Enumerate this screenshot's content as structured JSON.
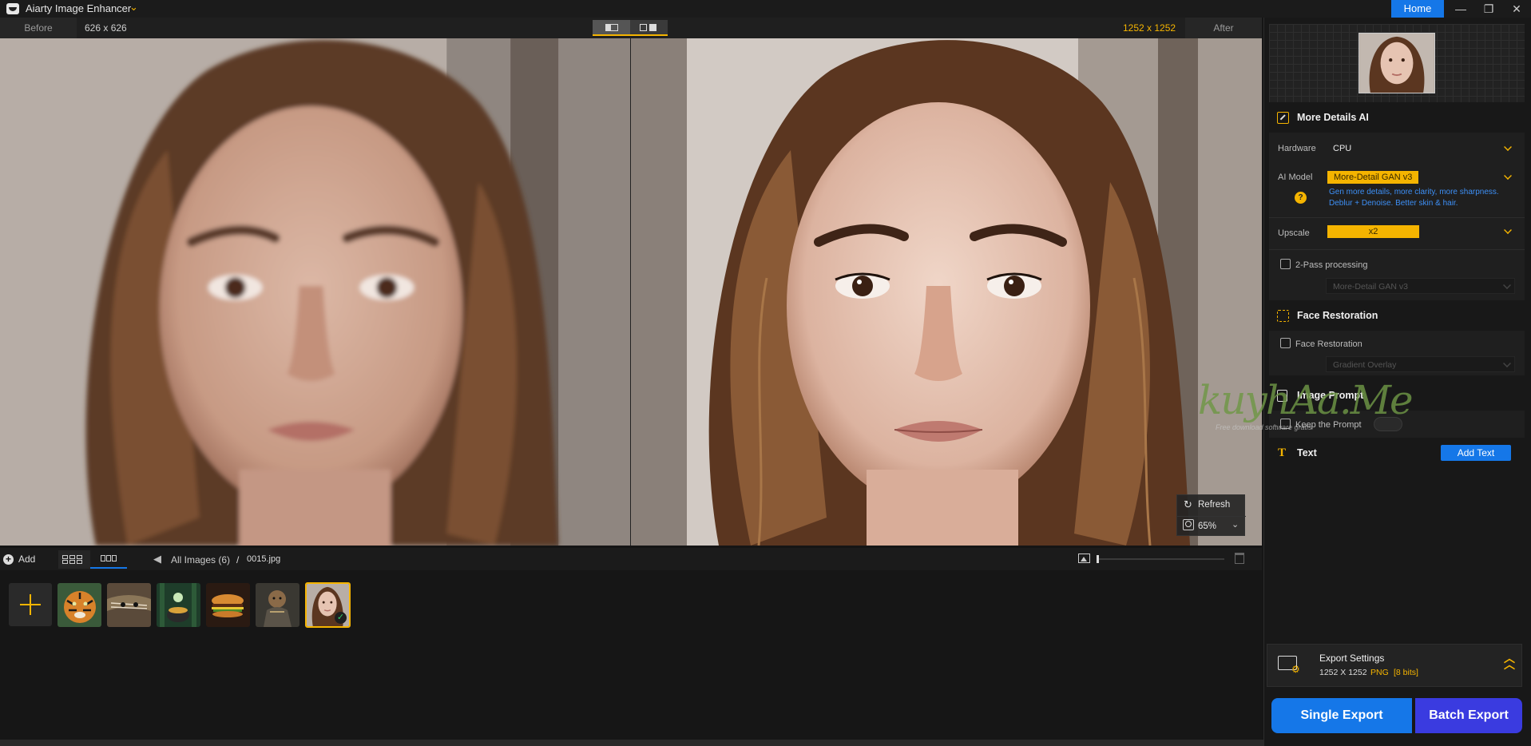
{
  "app": {
    "title": "Aiarty Image Enhancer",
    "home_label": "Home"
  },
  "window_controls": {
    "minimize": "—",
    "restore": "❐",
    "close": "✕"
  },
  "compare": {
    "before_label": "Before",
    "before_dims": "626 x 626",
    "after_dims": "1252 x 1252",
    "after_label": "After"
  },
  "overlay": {
    "refresh_label": "Refresh",
    "zoom_value": "65%"
  },
  "toolbar": {
    "add_label": "Add",
    "breadcrumb_all": "All Images (6)",
    "breadcrumb_sep": "/",
    "breadcrumb_file": "0015.jpg",
    "size_slider_percent": 0
  },
  "thumbnails": [
    {
      "name": "tiger",
      "selected": false
    },
    {
      "name": "owl-feathers",
      "selected": false
    },
    {
      "name": "forest-cauldron",
      "selected": false
    },
    {
      "name": "burger",
      "selected": false
    },
    {
      "name": "armored-figure",
      "selected": false
    },
    {
      "name": "portrait-woman",
      "selected": true
    }
  ],
  "panel": {
    "more_details": {
      "title": "More Details AI",
      "hardware_label": "Hardware",
      "hardware_value": "CPU",
      "ai_model_label": "AI Model",
      "ai_model_value": "More-Detail GAN  v3",
      "ai_model_desc_1": "Gen more details, more clarity, more sharpness.",
      "ai_model_desc_2": "Deblur + Denoise. Better skin & hair.",
      "help_glyph": "?",
      "upscale_label": "Upscale",
      "upscale_value": "x2",
      "two_pass_label": "2-Pass processing",
      "two_pass_model": "More-Detail GAN  v3"
    },
    "face_restoration": {
      "title": "Face Restoration",
      "checkbox_label": "Face Restoration",
      "model": "Gradient Overlay"
    },
    "image_prompt": {
      "title": "Image Prompt",
      "keep_label": "Keep the Prompt"
    },
    "text": {
      "title": "Text",
      "add_text_label": "Add Text"
    },
    "export": {
      "title": "Export Settings",
      "dims": "1252 X 1252",
      "format": "PNG",
      "bits": "[8 bits]",
      "single_label": "Single Export",
      "batch_label": "Batch Export"
    }
  },
  "watermark": {
    "brand": "kuyhAa.Me",
    "tagline": "Free download software gratis"
  },
  "colors": {
    "accent": "#f5b400",
    "primary_blue": "#1577e8",
    "batch_blue": "#3a3be0",
    "link_blue": "#3d8ff5"
  }
}
